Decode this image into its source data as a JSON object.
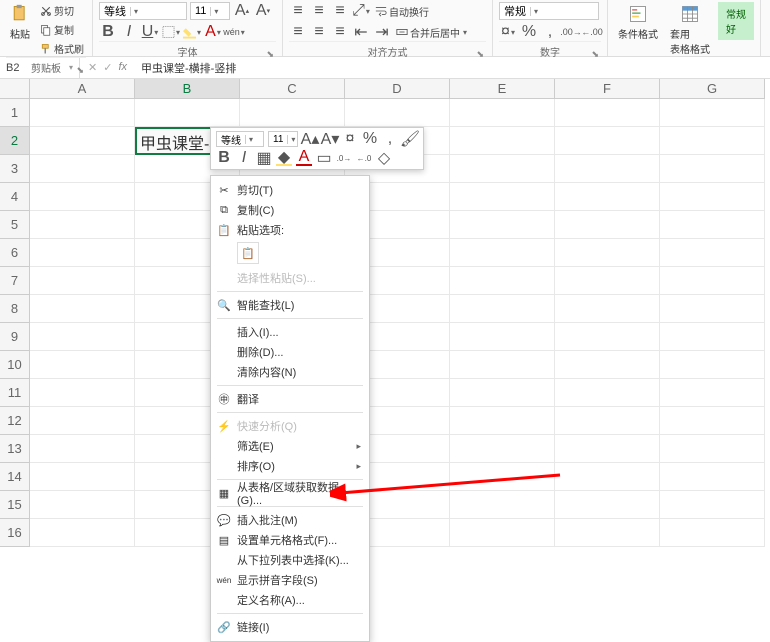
{
  "ribbon": {
    "clipboard": {
      "paste": "粘贴",
      "cut": "剪切",
      "copy": "复制",
      "fmtPainter": "格式刷",
      "label": "剪贴板"
    },
    "font": {
      "fontName": "等线",
      "fontSize": "11",
      "label": "字体"
    },
    "align": {
      "wrap": "自动换行",
      "merge": "合并后居中",
      "label": "对齐方式"
    },
    "number": {
      "format": "常规",
      "label": "数字"
    },
    "styles": {
      "condFmt": "条件格式",
      "tblFmt": "套用\n表格格式",
      "good": "常规\n好"
    }
  },
  "namebar": {
    "ref": "B2",
    "formula": "甲虫课堂-横排-竖排"
  },
  "cols": [
    "A",
    "B",
    "C",
    "D",
    "E",
    "F",
    "G"
  ],
  "rows": [
    "1",
    "2",
    "3",
    "4",
    "5",
    "6",
    "7",
    "8",
    "9",
    "10",
    "11",
    "12",
    "13",
    "14",
    "15",
    "16"
  ],
  "cell_b2": "甲虫课堂-横排-竖排",
  "mini": {
    "font": "等线",
    "size": "11"
  },
  "ctx": {
    "cut": "剪切(T)",
    "copy": "复制(C)",
    "pasteOpt": "粘贴选项:",
    "pasteSpecial": "选择性粘贴(S)...",
    "smartFind": "智能查找(L)",
    "insert": "插入(I)...",
    "delete": "删除(D)...",
    "clear": "清除内容(N)",
    "translate": "翻译",
    "quickAnalysis": "快速分析(Q)",
    "filter": "筛选(E)",
    "sort": "排序(O)",
    "fromTable": "从表格/区域获取数据(G)...",
    "insertComment": "插入批注(M)",
    "formatCells": "设置单元格格式(F)...",
    "pickFromList": "从下拉列表中选择(K)...",
    "showPinyin": "显示拼音字段(S)",
    "defineName": "定义名称(A)...",
    "link": "链接(I)"
  }
}
